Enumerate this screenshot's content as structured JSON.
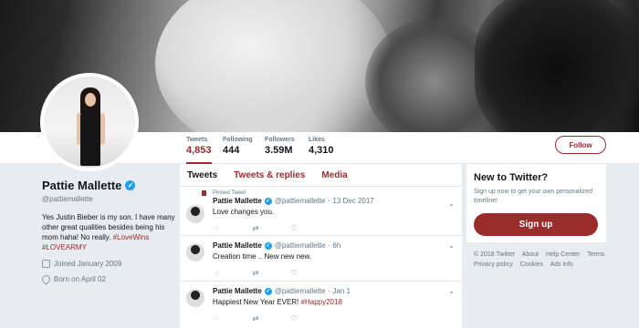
{
  "profile": {
    "name": "Pattie Mallette",
    "handle": "@pattiemallette",
    "bio_text": "Yes Justin Bieber is my son. I have many other great qualities besides being his mom haha! No really.",
    "bio_tag1": "#LoveWins",
    "bio_tag2": "#LOVEARMY",
    "joined": "Joined January 2009",
    "born": "Born on April 02"
  },
  "stats": [
    {
      "label": "Tweets",
      "value": "4,853"
    },
    {
      "label": "Following",
      "value": "444"
    },
    {
      "label": "Followers",
      "value": "3.59M"
    },
    {
      "label": "Likes",
      "value": "4,310"
    }
  ],
  "follow_label": "Follow",
  "tabs": [
    "Tweets",
    "Tweets & replies",
    "Media"
  ],
  "tweets": [
    {
      "pinned": "Pinned Tweet",
      "name": "Pattie Mallette",
      "handle": "@pattiemallette",
      "time": "· 13 Dec 2017",
      "text": "Love changes you.",
      "tag": ""
    },
    {
      "pinned": "",
      "name": "Pattie Mallette",
      "handle": "@pattiemallette",
      "time": "· 6h",
      "text": "Creation time .. New new new.",
      "tag": ""
    },
    {
      "pinned": "",
      "name": "Pattie Mallette",
      "handle": "@pattiemallette",
      "time": "· Jan 1",
      "text": "Happiest New Year EVER!",
      "tag": "#Happy2018"
    }
  ],
  "signup_box": {
    "title": "New to Twitter?",
    "subtitle": "Sign up now to get your own personalized timeline!",
    "button": "Sign up"
  },
  "footer": [
    "© 2018 Twitter",
    "About",
    "Help Center",
    "Terms",
    "Privacy policy",
    "Cookies",
    "Ads info"
  ],
  "icons": {
    "verified": "verified-badge-icon",
    "calendar": "calendar-icon",
    "location": "location-icon",
    "reply": "reply-icon",
    "retweet": "retweet-icon",
    "like": "heart-icon",
    "chevron": "chevron-down-icon",
    "pin": "pin-icon"
  },
  "colors": {
    "accent": "#9b2c2c",
    "verified": "#1da1f2",
    "background": "#e6ecf0"
  }
}
